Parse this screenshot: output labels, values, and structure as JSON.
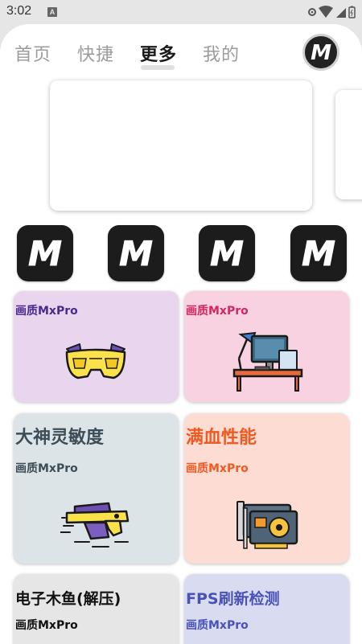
{
  "status": {
    "time": "3:02",
    "notification": "A"
  },
  "tabs": [
    {
      "label": "首页"
    },
    {
      "label": "快捷"
    },
    {
      "label": "更多"
    },
    {
      "label": "我的"
    }
  ],
  "active_tab": "更多",
  "avatar": {
    "text": "M"
  },
  "shortcuts": [
    {
      "icon": "mxpro-logo-icon",
      "text": "M"
    },
    {
      "icon": "mxpro-logo-icon",
      "text": "M"
    },
    {
      "icon": "mxpro-logo-icon",
      "text": "M"
    },
    {
      "icon": "mxpro-logo-icon",
      "text": "M"
    }
  ],
  "cards": [
    {
      "title": "",
      "subtitle": "画质MxPro",
      "bg": "#ead5ef",
      "title_color": "#4a2a8c",
      "sub_color": "#4a2a8c",
      "icon": "goggles-icon"
    },
    {
      "title": "",
      "subtitle": "画质MxPro",
      "bg": "#f8d2e0",
      "title_color": "#d6265f",
      "sub_color": "#d6265f",
      "icon": "desk-computer-icon"
    },
    {
      "title": "大神灵敏度",
      "subtitle": "画质MxPro",
      "bg": "#dde4e8",
      "title_color": "#3d4d57",
      "sub_color": "#3d4d57",
      "icon": "blaster-gun-icon"
    },
    {
      "title": "满血性能",
      "subtitle": "画质MxPro",
      "bg": "#fdddd3",
      "title_color": "#f05a22",
      "sub_color": "#f05a22",
      "icon": "graphics-card-icon"
    },
    {
      "title": "电子木鱼(解压)",
      "subtitle": "画质MxPro",
      "bg": "#e6e6e6",
      "title_color": "#111111",
      "sub_color": "#111111",
      "icon": ""
    },
    {
      "title": "FPS刷新检测",
      "subtitle": "画质MxPro",
      "bg": "#d9dcf1",
      "title_color": "#4a52b8",
      "sub_color": "#4a52b8",
      "icon": ""
    }
  ]
}
